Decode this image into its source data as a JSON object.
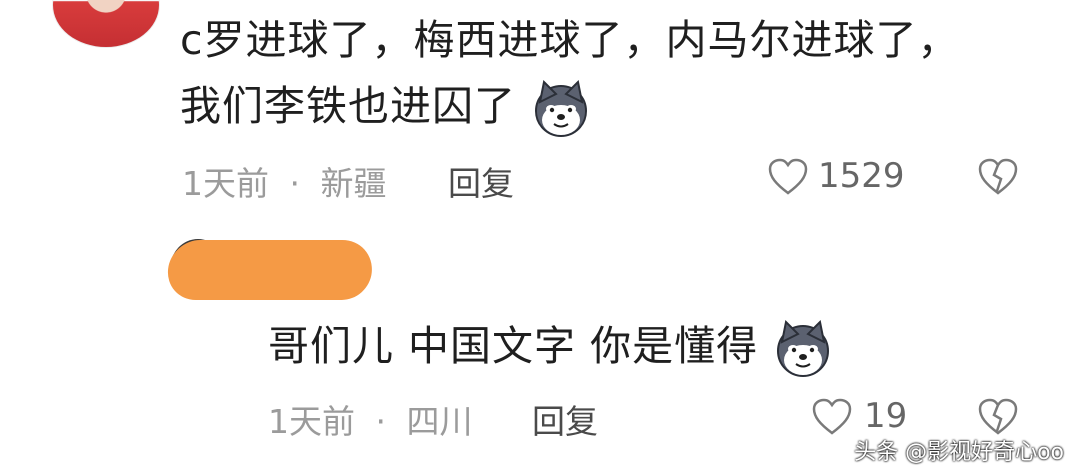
{
  "comments": [
    {
      "line1": "c罗进球了，梅西进球了，内马尔进球了，",
      "line2": "我们李铁也进囚了",
      "time": "1天前",
      "location": "新疆",
      "reply": "回复",
      "likes": "1529",
      "emoji": "husky-doge-emoji"
    },
    {
      "text": "哥们儿 中国文字  你是懂得",
      "time": "1天前",
      "location": "四川",
      "reply": "回复",
      "likes": "19",
      "emoji": "husky-doge-emoji"
    }
  ],
  "separator": "·",
  "watermark": "头条 @影视好奇心oo",
  "colors": {
    "text": "#1f1f1f",
    "meta": "#9b9b9b",
    "redaction": "#f59a45"
  },
  "icons": [
    "heart-outline-icon",
    "broken-heart-icon"
  ]
}
